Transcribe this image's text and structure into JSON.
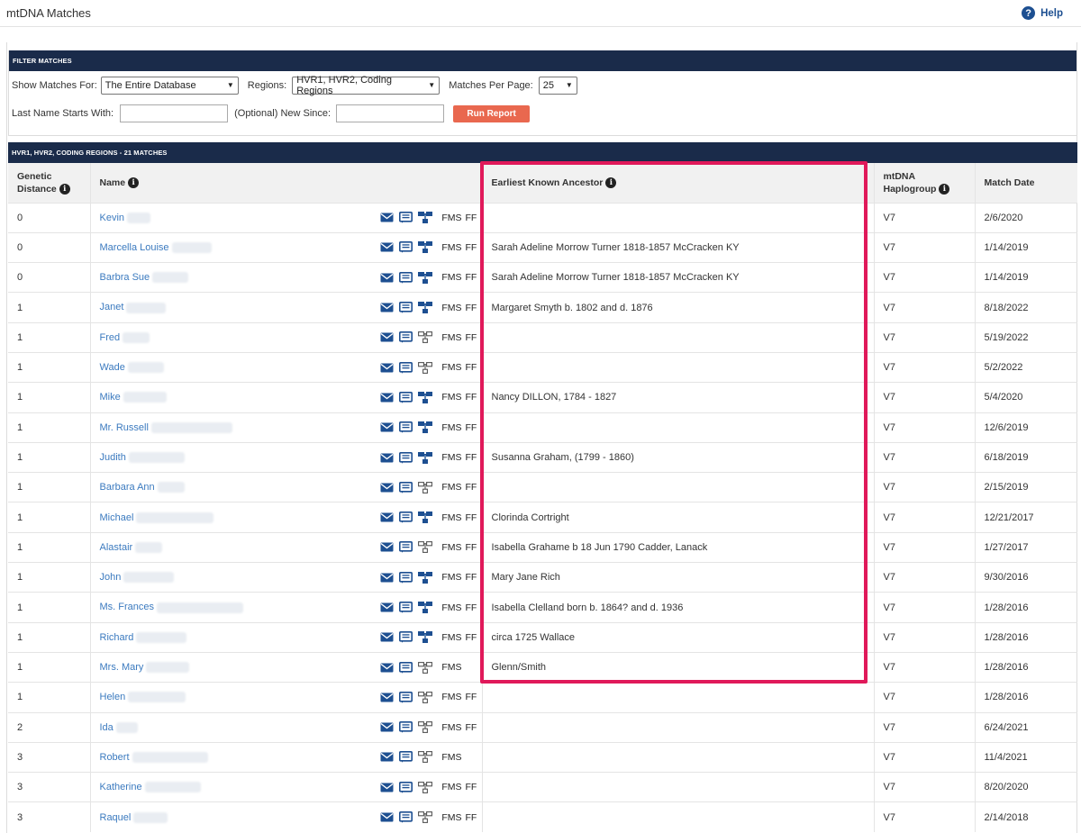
{
  "header": {
    "title": "mtDNA Matches",
    "help_label": "Help"
  },
  "filter": {
    "section_title": "FILTER MATCHES",
    "show_matches_label": "Show Matches For:",
    "show_matches_value": "The Entire Database",
    "regions_label": "Regions:",
    "regions_value": "HVR1, HVR2, Coding Regions",
    "per_page_label": "Matches Per Page:",
    "per_page_value": "25",
    "last_name_label": "Last Name Starts With:",
    "last_name_value": "",
    "new_since_label": "(Optional) New Since:",
    "new_since_value": "",
    "run_button": "Run Report"
  },
  "results": {
    "section_title": "HVR1, HVR2, CODING REGIONS - 21 MATCHES",
    "columns": {
      "genetic_distance_1": "Genetic",
      "genetic_distance_2": "Distance",
      "name": "Name",
      "ancestor": "Earliest Known Ancestor",
      "haplogroup_1": "mtDNA",
      "haplogroup_2": "Haplogroup",
      "match_date": "Match Date"
    },
    "rows": [
      {
        "gd": "0",
        "name": "Kevin",
        "blur": 26,
        "tree": true,
        "fms": "FMS",
        "ff": "FF",
        "ancestor": "",
        "hap": "V7",
        "date": "2/6/2020"
      },
      {
        "gd": "0",
        "name": "Marcella Louise",
        "blur": 44,
        "tree": true,
        "fms": "FMS",
        "ff": "FF",
        "ancestor": "Sarah Adeline Morrow Turner 1818-1857 McCracken KY",
        "hap": "V7",
        "date": "1/14/2019"
      },
      {
        "gd": "0",
        "name": "Barbra Sue",
        "blur": 40,
        "tree": true,
        "fms": "FMS",
        "ff": "FF",
        "ancestor": "Sarah Adeline Morrow Turner 1818-1857 McCracken KY",
        "hap": "V7",
        "date": "1/14/2019"
      },
      {
        "gd": "1",
        "name": "Janet",
        "blur": 44,
        "tree": true,
        "fms": "FMS",
        "ff": "FF",
        "ancestor": "Margaret Smyth b. 1802 and d. 1876",
        "hap": "V7",
        "date": "8/18/2022"
      },
      {
        "gd": "1",
        "name": "Fred",
        "blur": 30,
        "tree": false,
        "fms": "FMS",
        "ff": "FF",
        "ancestor": "",
        "hap": "V7",
        "date": "5/19/2022"
      },
      {
        "gd": "1",
        "name": "Wade",
        "blur": 40,
        "tree": false,
        "fms": "FMS",
        "ff": "FF",
        "ancestor": "",
        "hap": "V7",
        "date": "5/2/2022"
      },
      {
        "gd": "1",
        "name": "Mike",
        "blur": 48,
        "tree": true,
        "fms": "FMS",
        "ff": "FF",
        "ancestor": "Nancy DILLON, 1784 - 1827",
        "hap": "V7",
        "date": "5/4/2020"
      },
      {
        "gd": "1",
        "name": "Mr. Russell",
        "blur": 90,
        "tree": true,
        "fms": "FMS",
        "ff": "FF",
        "ancestor": "",
        "hap": "V7",
        "date": "12/6/2019"
      },
      {
        "gd": "1",
        "name": "Judith",
        "blur": 62,
        "tree": true,
        "fms": "FMS",
        "ff": "FF",
        "ancestor": "Susanna Graham, (1799 - 1860)",
        "hap": "V7",
        "date": "6/18/2019"
      },
      {
        "gd": "1",
        "name": "Barbara Ann",
        "blur": 30,
        "tree": false,
        "fms": "FMS",
        "ff": "FF",
        "ancestor": "",
        "hap": "V7",
        "date": "2/15/2019"
      },
      {
        "gd": "1",
        "name": "Michael",
        "blur": 86,
        "tree": true,
        "fms": "FMS",
        "ff": "FF",
        "ancestor": "Clorinda Cortright",
        "hap": "V7",
        "date": "12/21/2017"
      },
      {
        "gd": "1",
        "name": "Alastair",
        "blur": 30,
        "tree": false,
        "fms": "FMS",
        "ff": "FF",
        "ancestor": "Isabella Grahame b 18 Jun 1790 Cadder, Lanack",
        "hap": "V7",
        "date": "1/27/2017"
      },
      {
        "gd": "1",
        "name": "John",
        "blur": 56,
        "tree": true,
        "fms": "FMS",
        "ff": "FF",
        "ancestor": "Mary Jane Rich",
        "hap": "V7",
        "date": "9/30/2016"
      },
      {
        "gd": "1",
        "name": "Ms. Frances",
        "blur": 96,
        "tree": true,
        "fms": "FMS",
        "ff": "FF",
        "ancestor": "Isabella Clelland born b. 1864? and d. 1936",
        "hap": "V7",
        "date": "1/28/2016"
      },
      {
        "gd": "1",
        "name": "Richard",
        "blur": 56,
        "tree": true,
        "fms": "FMS",
        "ff": "FF",
        "ancestor": "circa 1725 Wallace",
        "hap": "V7",
        "date": "1/28/2016"
      },
      {
        "gd": "1",
        "name": "Mrs. Mary",
        "blur": 48,
        "tree": false,
        "fms": "FMS",
        "ff": "",
        "ancestor": "Glenn/Smith",
        "hap": "V7",
        "date": "1/28/2016"
      },
      {
        "gd": "1",
        "name": "Helen",
        "blur": 64,
        "tree": false,
        "fms": "FMS",
        "ff": "FF",
        "ancestor": "",
        "hap": "V7",
        "date": "1/28/2016"
      },
      {
        "gd": "2",
        "name": "Ida",
        "blur": 24,
        "tree": false,
        "fms": "FMS",
        "ff": "FF",
        "ancestor": "",
        "hap": "V7",
        "date": "6/24/2021"
      },
      {
        "gd": "3",
        "name": "Robert",
        "blur": 84,
        "tree": false,
        "fms": "FMS",
        "ff": "",
        "ancestor": "",
        "hap": "V7",
        "date": "11/4/2021"
      },
      {
        "gd": "3",
        "name": "Katherine",
        "blur": 62,
        "tree": false,
        "fms": "FMS",
        "ff": "FF",
        "ancestor": "",
        "hap": "V7",
        "date": "8/20/2020"
      },
      {
        "gd": "3",
        "name": "Raquel",
        "blur": 38,
        "tree": false,
        "fms": "FMS",
        "ff": "FF",
        "ancestor": "",
        "hap": "V7",
        "date": "2/14/2018"
      }
    ]
  },
  "colors": {
    "nav_bar": "#1a2b4a",
    "link": "#3b7abf",
    "icon_blue": "#1d4f91",
    "run_button": "#e9684f",
    "highlight": "#e0195a"
  }
}
